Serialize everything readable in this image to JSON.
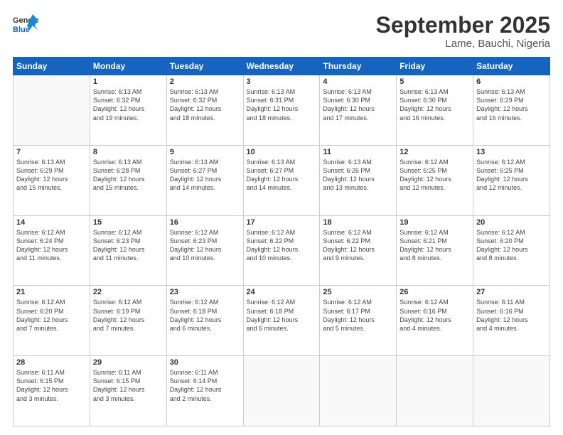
{
  "header": {
    "logo_general": "General",
    "logo_blue": "Blue",
    "title": "September 2025",
    "subtitle": "Lame, Bauchi, Nigeria"
  },
  "days_of_week": [
    "Sunday",
    "Monday",
    "Tuesday",
    "Wednesday",
    "Thursday",
    "Friday",
    "Saturday"
  ],
  "weeks": [
    [
      {
        "day": "",
        "info": ""
      },
      {
        "day": "1",
        "info": "Sunrise: 6:13 AM\nSunset: 6:32 PM\nDaylight: 12 hours\nand 19 minutes."
      },
      {
        "day": "2",
        "info": "Sunrise: 6:13 AM\nSunset: 6:32 PM\nDaylight: 12 hours\nand 18 minutes."
      },
      {
        "day": "3",
        "info": "Sunrise: 6:13 AM\nSunset: 6:31 PM\nDaylight: 12 hours\nand 18 minutes."
      },
      {
        "day": "4",
        "info": "Sunrise: 6:13 AM\nSunset: 6:30 PM\nDaylight: 12 hours\nand 17 minutes."
      },
      {
        "day": "5",
        "info": "Sunrise: 6:13 AM\nSunset: 6:30 PM\nDaylight: 12 hours\nand 16 minutes."
      },
      {
        "day": "6",
        "info": "Sunrise: 6:13 AM\nSunset: 6:29 PM\nDaylight: 12 hours\nand 16 minutes."
      }
    ],
    [
      {
        "day": "7",
        "info": "Sunrise: 6:13 AM\nSunset: 6:29 PM\nDaylight: 12 hours\nand 15 minutes."
      },
      {
        "day": "8",
        "info": "Sunrise: 6:13 AM\nSunset: 6:28 PM\nDaylight: 12 hours\nand 15 minutes."
      },
      {
        "day": "9",
        "info": "Sunrise: 6:13 AM\nSunset: 6:27 PM\nDaylight: 12 hours\nand 14 minutes."
      },
      {
        "day": "10",
        "info": "Sunrise: 6:13 AM\nSunset: 6:27 PM\nDaylight: 12 hours\nand 14 minutes."
      },
      {
        "day": "11",
        "info": "Sunrise: 6:13 AM\nSunset: 6:26 PM\nDaylight: 12 hours\nand 13 minutes."
      },
      {
        "day": "12",
        "info": "Sunrise: 6:12 AM\nSunset: 6:25 PM\nDaylight: 12 hours\nand 12 minutes."
      },
      {
        "day": "13",
        "info": "Sunrise: 6:12 AM\nSunset: 6:25 PM\nDaylight: 12 hours\nand 12 minutes."
      }
    ],
    [
      {
        "day": "14",
        "info": "Sunrise: 6:12 AM\nSunset: 6:24 PM\nDaylight: 12 hours\nand 11 minutes."
      },
      {
        "day": "15",
        "info": "Sunrise: 6:12 AM\nSunset: 6:23 PM\nDaylight: 12 hours\nand 11 minutes."
      },
      {
        "day": "16",
        "info": "Sunrise: 6:12 AM\nSunset: 6:23 PM\nDaylight: 12 hours\nand 10 minutes."
      },
      {
        "day": "17",
        "info": "Sunrise: 6:12 AM\nSunset: 6:22 PM\nDaylight: 12 hours\nand 10 minutes."
      },
      {
        "day": "18",
        "info": "Sunrise: 6:12 AM\nSunset: 6:22 PM\nDaylight: 12 hours\nand 9 minutes."
      },
      {
        "day": "19",
        "info": "Sunrise: 6:12 AM\nSunset: 6:21 PM\nDaylight: 12 hours\nand 8 minutes."
      },
      {
        "day": "20",
        "info": "Sunrise: 6:12 AM\nSunset: 6:20 PM\nDaylight: 12 hours\nand 8 minutes."
      }
    ],
    [
      {
        "day": "21",
        "info": "Sunrise: 6:12 AM\nSunset: 6:20 PM\nDaylight: 12 hours\nand 7 minutes."
      },
      {
        "day": "22",
        "info": "Sunrise: 6:12 AM\nSunset: 6:19 PM\nDaylight: 12 hours\nand 7 minutes."
      },
      {
        "day": "23",
        "info": "Sunrise: 6:12 AM\nSunset: 6:18 PM\nDaylight: 12 hours\nand 6 minutes."
      },
      {
        "day": "24",
        "info": "Sunrise: 6:12 AM\nSunset: 6:18 PM\nDaylight: 12 hours\nand 6 minutes."
      },
      {
        "day": "25",
        "info": "Sunrise: 6:12 AM\nSunset: 6:17 PM\nDaylight: 12 hours\nand 5 minutes."
      },
      {
        "day": "26",
        "info": "Sunrise: 6:12 AM\nSunset: 6:16 PM\nDaylight: 12 hours\nand 4 minutes."
      },
      {
        "day": "27",
        "info": "Sunrise: 6:11 AM\nSunset: 6:16 PM\nDaylight: 12 hours\nand 4 minutes."
      }
    ],
    [
      {
        "day": "28",
        "info": "Sunrise: 6:11 AM\nSunset: 6:15 PM\nDaylight: 12 hours\nand 3 minutes."
      },
      {
        "day": "29",
        "info": "Sunrise: 6:11 AM\nSunset: 6:15 PM\nDaylight: 12 hours\nand 3 minutes."
      },
      {
        "day": "30",
        "info": "Sunrise: 6:11 AM\nSunset: 6:14 PM\nDaylight: 12 hours\nand 2 minutes."
      },
      {
        "day": "",
        "info": ""
      },
      {
        "day": "",
        "info": ""
      },
      {
        "day": "",
        "info": ""
      },
      {
        "day": "",
        "info": ""
      }
    ]
  ]
}
